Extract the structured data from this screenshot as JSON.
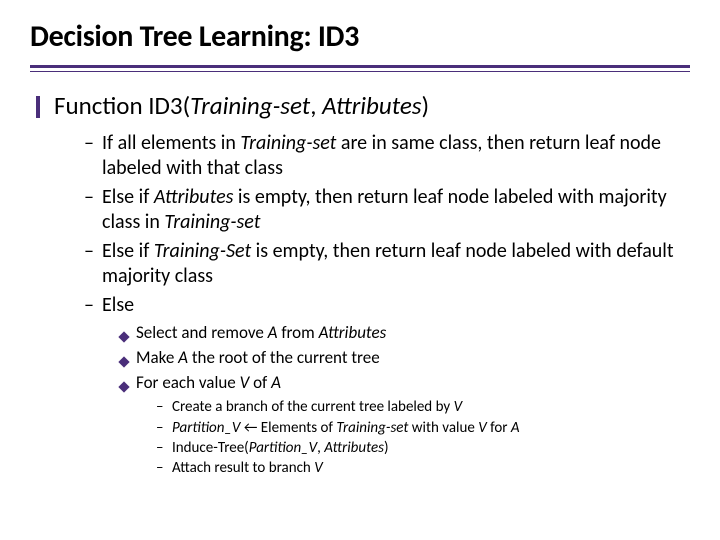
{
  "title": "Decision Tree Learning: ID3",
  "lvl1_pre": "Function ID3(",
  "lvl1_arg1": "Training-set",
  "lvl1_sep": ", ",
  "lvl1_arg2": "Attributes",
  "lvl1_post": ")",
  "b1_a": "If all elements in ",
  "b1_b": "Training-set",
  "b1_c": " are in same class, then return leaf node labeled with that class",
  "b2_a": "Else if ",
  "b2_b": "Attributes",
  "b2_c": " is empty, then return leaf node labeled with majority class in ",
  "b2_d": "Training-set",
  "b3_a": "Else if ",
  "b3_b": "Training-Set",
  "b3_c": " is empty, then return leaf node labeled with default majority class",
  "b4": "Else",
  "s1_a": "Select and remove ",
  "s1_b": "A",
  "s1_c": " from ",
  "s1_d": "Attributes",
  "s2_a": "Make ",
  "s2_b": "A",
  "s2_c": " the root of the current tree",
  "s3_a": "For each value ",
  "s3_b": "V",
  "s3_c": " of ",
  "s3_d": "A",
  "d1_a": "Create a branch of the current tree labeled by ",
  "d1_b": "V",
  "d2_a": "Partition_V",
  "d2_b": " ← Elements of ",
  "d2_c": "Training-set",
  "d2_d": " with value ",
  "d2_e": "V",
  "d2_f": " for ",
  "d2_g": "A",
  "d3_a": "Induce-Tree(",
  "d3_b": "Partition_V",
  "d3_c": ", ",
  "d3_d": "Attributes",
  "d3_e": ")",
  "d4_a": "Attach result to branch ",
  "d4_b": "V"
}
